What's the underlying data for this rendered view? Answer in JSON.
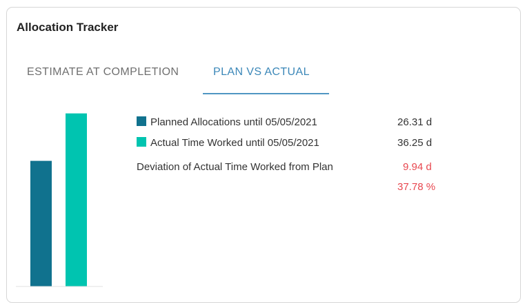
{
  "card": {
    "title": "Allocation Tracker"
  },
  "tabs": [
    {
      "label": "ESTIMATE AT COMPLETION",
      "active": false
    },
    {
      "label": "PLAN VS ACTUAL",
      "active": true
    }
  ],
  "legend": {
    "planned": {
      "label": "Planned Allocations until 05/05/2021",
      "value": "26.31 d"
    },
    "actual": {
      "label": "Actual Time Worked until 05/05/2021",
      "value": "36.25 d"
    },
    "deviation": {
      "label": "Deviation of Actual Time Worked from Plan",
      "value_days": "9.94 d",
      "value_percent": "37.78 %"
    }
  },
  "colors": {
    "planned": "#10728e",
    "actual": "#00c4b0",
    "deviation": "#e8474f",
    "tab_active": "#3b87b8"
  },
  "chart_data": {
    "type": "bar",
    "categories": [
      "Planned Allocations",
      "Actual Time Worked"
    ],
    "values": [
      26.31,
      36.25
    ],
    "ylim": [
      0,
      37.5
    ],
    "grid": false,
    "legend_placement": "right"
  }
}
